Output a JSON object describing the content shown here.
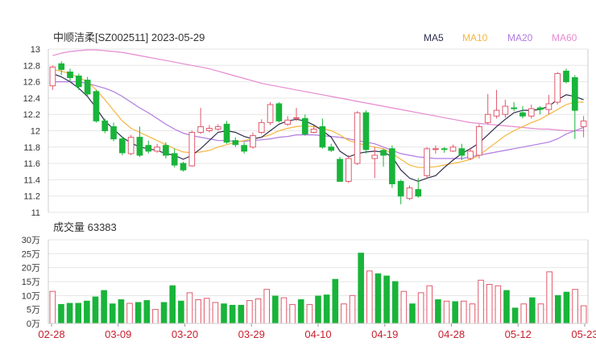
{
  "chart_data": [
    {
      "type": "candlestick",
      "title": "中顺洁柔[SZ002511] 2023-05-29",
      "legend": [
        {
          "name": "MA5",
          "color": "#2e2e4e"
        },
        {
          "name": "MA10",
          "color": "#f4b63f"
        },
        {
          "name": "MA20",
          "color": "#b27ae0"
        },
        {
          "name": "MA60",
          "color": "#e68ad0"
        }
      ],
      "up_color": "#e05a6c",
      "down_color": "#19b43a",
      "yticks": [
        "13",
        "12.8",
        "12.6",
        "12.4",
        "12.2",
        "12",
        "11.8",
        "11.6",
        "11.4",
        "11.2",
        "11"
      ],
      "ylim": [
        11,
        13
      ],
      "candles": [
        [
          12.55,
          12.78,
          12.8,
          12.5
        ],
        [
          12.82,
          12.75,
          12.85,
          12.68
        ],
        [
          12.72,
          12.65,
          12.76,
          12.6
        ],
        [
          12.67,
          12.54,
          12.7,
          12.5
        ],
        [
          12.62,
          12.45,
          12.66,
          12.42
        ],
        [
          12.48,
          12.12,
          12.5,
          12.1
        ],
        [
          12.12,
          12.0,
          12.15,
          11.97
        ],
        [
          12.05,
          11.9,
          12.1,
          11.87
        ],
        [
          11.9,
          11.73,
          11.93,
          11.7
        ],
        [
          11.72,
          11.92,
          11.95,
          11.7
        ],
        [
          11.92,
          11.7,
          12.05,
          11.68
        ],
        [
          11.82,
          11.75,
          11.88,
          11.72
        ],
        [
          11.75,
          11.8,
          11.84,
          11.73
        ],
        [
          11.82,
          11.7,
          11.86,
          11.66
        ],
        [
          11.72,
          11.58,
          11.78,
          11.55
        ],
        [
          11.6,
          11.52,
          11.62,
          11.5
        ],
        [
          11.57,
          11.98,
          12.0,
          11.56
        ],
        [
          11.98,
          12.05,
          12.28,
          11.96
        ],
        [
          12.0,
          12.03,
          12.07,
          11.98
        ],
        [
          12.02,
          12.05,
          12.08,
          12.0
        ],
        [
          12.08,
          11.86,
          12.12,
          11.84
        ],
        [
          11.88,
          11.83,
          11.92,
          11.8
        ],
        [
          11.82,
          11.75,
          11.86,
          11.72
        ],
        [
          11.8,
          11.94,
          11.98,
          11.78
        ],
        [
          11.98,
          12.1,
          12.14,
          11.96
        ],
        [
          12.1,
          12.32,
          12.35,
          12.07
        ],
        [
          12.33,
          12.12,
          12.35,
          12.1
        ],
        [
          12.08,
          12.13,
          12.18,
          12.06
        ],
        [
          12.15,
          12.16,
          12.28,
          12.12
        ],
        [
          12.15,
          11.96,
          12.2,
          11.94
        ],
        [
          11.98,
          12.02,
          12.06,
          11.97
        ],
        [
          12.05,
          11.8,
          12.15,
          11.78
        ],
        [
          11.8,
          11.76,
          11.84,
          11.74
        ],
        [
          11.65,
          11.38,
          11.68,
          11.38
        ],
        [
          11.38,
          11.66,
          11.7,
          11.36
        ],
        [
          11.6,
          12.22,
          12.24,
          11.58
        ],
        [
          12.22,
          11.77,
          12.25,
          11.72
        ],
        [
          11.66,
          11.7,
          11.8,
          11.42
        ],
        [
          11.76,
          11.7,
          11.78,
          11.56
        ],
        [
          11.78,
          11.35,
          11.82,
          11.3
        ],
        [
          11.38,
          11.2,
          11.4,
          11.1
        ],
        [
          11.17,
          11.3,
          11.33,
          11.15
        ],
        [
          11.28,
          11.2,
          11.42,
          11.18
        ],
        [
          11.45,
          11.78,
          11.8,
          11.42
        ],
        [
          11.78,
          11.78,
          11.82,
          11.72
        ],
        [
          11.78,
          11.77,
          11.8,
          11.73
        ],
        [
          11.75,
          11.8,
          11.83,
          11.74
        ],
        [
          11.78,
          11.7,
          11.84,
          11.64
        ],
        [
          11.66,
          11.75,
          11.78,
          11.64
        ],
        [
          11.7,
          12.05,
          12.08,
          11.66
        ],
        [
          12.1,
          12.2,
          12.45,
          12.08
        ],
        [
          12.18,
          12.25,
          12.5,
          12.15
        ],
        [
          12.2,
          12.3,
          12.38,
          12.16
        ],
        [
          12.28,
          12.27,
          12.35,
          12.24
        ],
        [
          12.22,
          12.18,
          12.3,
          12.15
        ],
        [
          12.18,
          12.27,
          12.32,
          12.15
        ],
        [
          12.28,
          12.26,
          12.3,
          12.2
        ],
        [
          12.26,
          12.33,
          12.44,
          12.2
        ],
        [
          12.35,
          12.7,
          12.72,
          12.32
        ],
        [
          12.73,
          12.6,
          12.76,
          12.58
        ],
        [
          12.65,
          12.25,
          12.68,
          11.9
        ],
        [
          12.05,
          12.12,
          12.18,
          11.92
        ]
      ],
      "ma5": [
        12.7,
        12.66,
        12.6,
        12.52,
        12.42,
        12.28,
        12.12,
        12.02,
        11.92,
        11.85,
        11.8,
        11.78,
        11.76,
        11.72,
        11.7,
        11.65,
        11.7,
        11.78,
        11.88,
        11.98,
        12.0,
        11.98,
        11.93,
        11.9,
        11.92,
        12.0,
        12.08,
        12.12,
        12.14,
        12.12,
        12.07,
        12.0,
        11.92,
        11.75,
        11.68,
        11.72,
        11.74,
        11.75,
        11.74,
        11.68,
        11.52,
        11.42,
        11.38,
        11.42,
        11.45,
        11.55,
        11.64,
        11.72,
        11.78,
        11.85,
        11.95,
        12.05,
        12.14,
        12.22,
        12.25,
        12.25,
        12.26,
        12.3,
        12.38,
        12.44,
        12.42,
        12.38
      ],
      "ma10": [
        12.75,
        12.73,
        12.7,
        12.65,
        12.6,
        12.5,
        12.38,
        12.25,
        12.12,
        12.03,
        11.98,
        11.93,
        11.88,
        11.83,
        11.78,
        11.74,
        11.73,
        11.74,
        11.76,
        11.8,
        11.83,
        11.86,
        11.88,
        11.9,
        11.92,
        11.95,
        12.0,
        12.03,
        12.05,
        12.06,
        12.05,
        12.03,
        12.0,
        11.95,
        11.88,
        11.85,
        11.82,
        11.8,
        11.78,
        11.72,
        11.65,
        11.58,
        11.55,
        11.55,
        11.56,
        11.58,
        11.6,
        11.62,
        11.65,
        11.7,
        11.78,
        11.86,
        11.94,
        12.0,
        12.05,
        12.1,
        12.14,
        12.2,
        12.26,
        12.32,
        12.35,
        12.35
      ],
      "ma20": [
        12.6,
        12.6,
        12.6,
        12.6,
        12.58,
        12.55,
        12.52,
        12.48,
        12.42,
        12.35,
        12.28,
        12.22,
        12.15,
        12.08,
        12.02,
        11.97,
        11.94,
        11.92,
        11.9,
        11.88,
        11.88,
        11.87,
        11.87,
        11.88,
        11.89,
        11.9,
        11.92,
        11.93,
        11.95,
        11.95,
        11.95,
        11.94,
        11.93,
        11.92,
        11.9,
        11.88,
        11.86,
        11.84,
        11.8,
        11.76,
        11.72,
        11.7,
        11.68,
        11.67,
        11.66,
        11.66,
        11.66,
        11.66,
        11.68,
        11.7,
        11.72,
        11.74,
        11.76,
        11.78,
        11.8,
        11.82,
        11.84,
        11.86,
        11.9,
        11.96,
        12.0,
        12.04
      ],
      "ma60": [
        12.92,
        12.95,
        12.97,
        12.98,
        12.99,
        12.99,
        12.98,
        12.97,
        12.96,
        12.94,
        12.92,
        12.9,
        12.88,
        12.86,
        12.84,
        12.82,
        12.8,
        12.78,
        12.76,
        12.73,
        12.7,
        12.67,
        12.64,
        12.61,
        12.58,
        12.56,
        12.54,
        12.52,
        12.5,
        12.48,
        12.46,
        12.44,
        12.42,
        12.4,
        12.38,
        12.36,
        12.34,
        12.32,
        12.3,
        12.28,
        12.26,
        12.24,
        12.22,
        12.2,
        12.18,
        12.16,
        12.14,
        12.12,
        12.1,
        12.09,
        12.08,
        12.07,
        12.06,
        12.05,
        12.04,
        12.03,
        12.02,
        12.02,
        12.01,
        12.0,
        12.0,
        12.0
      ]
    },
    {
      "type": "bar",
      "title": "成交量 63383",
      "yticks": [
        "30万",
        "25万",
        "20万",
        "15万",
        "10万",
        "5万",
        "0万"
      ],
      "ylim": [
        0,
        300000
      ],
      "volumes": [
        115000,
        68000,
        72000,
        72000,
        80000,
        95000,
        118000,
        70000,
        85000,
        72000,
        75000,
        82000,
        50000,
        75000,
        135000,
        80000,
        110000,
        85000,
        90000,
        75000,
        70000,
        65000,
        65000,
        82000,
        88000,
        122000,
        98000,
        92000,
        68000,
        85000,
        68000,
        98000,
        102000,
        158000,
        70000,
        100000,
        252000,
        188000,
        178000,
        170000,
        150000,
        115000,
        70000,
        110000,
        135000,
        85000,
        80000,
        78000,
        80000,
        70000,
        155000,
        140000,
        135000,
        118000,
        55000,
        70000,
        92000,
        70000,
        185000,
        100000,
        112000,
        122000,
        63383
      ],
      "xticks": [
        "02-28",
        "03-09",
        "03-20",
        "03-29",
        "04-10",
        "04-19",
        "04-28",
        "05-12",
        "05-23"
      ]
    }
  ]
}
